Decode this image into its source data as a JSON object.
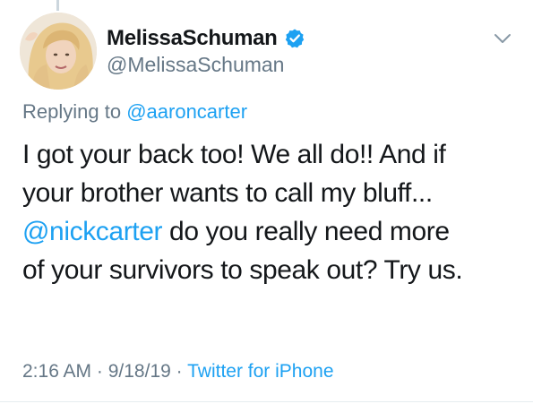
{
  "user": {
    "display_name": "MelissaSchuman",
    "handle": "@MelissaSchuman",
    "verified": true,
    "avatar_icon": "profile-photo"
  },
  "reply_context": {
    "prefix": "Replying to",
    "mention": "@aaroncarter"
  },
  "tweet": {
    "line1": "I got your back too! We all do!! And if",
    "line2": "your brother wants to call my bluff...",
    "line3_mention": "@nickcarter",
    "line3_rest": " do you really need more",
    "line4": "of your survivors to speak out? Try us."
  },
  "meta": {
    "time": "2:16 AM",
    "separator1": " · ",
    "date": "9/18/19",
    "separator2": " · ",
    "source": "Twitter for iPhone"
  },
  "icons": {
    "verified": "verified-badge-icon",
    "more": "chevron-down-icon"
  },
  "colors": {
    "link": "#1da1f2",
    "text": "#14171a",
    "muted": "#657786"
  }
}
